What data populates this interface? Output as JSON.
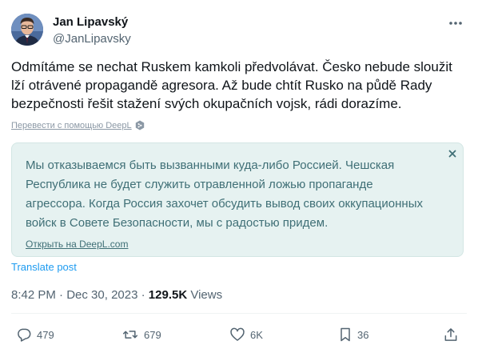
{
  "author": {
    "name": "Jan Lipavský",
    "handle": "@JanLipavsky"
  },
  "tweet": {
    "lines": [
      "Odmítáme se nechat Ruskem kamkoli předvolávat. Česko nebude sloužit",
      "lží otrávené propagandě agresora. Až bude chtít Rusko na půdě Rady",
      "bezpečnosti řešit stažení svých okupačních vojsk, rádi dorazíme."
    ]
  },
  "deepl_credit": "Перевести с помощью DeepL",
  "translation": {
    "lines": [
      "Мы отказываемся быть вызванными куда-либо Россией. Чешская",
      "Республика не будет служить отравленной ложью пропаганде",
      "агрессора. Когда Россия захочет обсудить вывод своих оккупационных",
      "войск в Совете Безопасности, мы с радостью придем."
    ],
    "open_link": "Открыть на DeepL.com"
  },
  "translate_post": "Translate post",
  "meta": {
    "time": "8:42 PM",
    "separator": "·",
    "date": "Dec 30, 2023",
    "views_count": "129.5K",
    "views_label": "Views"
  },
  "actions": {
    "replies": "479",
    "reposts": "679",
    "likes": "6K",
    "bookmarks": "36"
  },
  "icons": {
    "more": "more-horizontal-icon",
    "reply": "reply-icon",
    "repost": "repost-icon",
    "like": "heart-icon",
    "bookmark": "bookmark-icon",
    "share": "share-icon",
    "close": "close-icon",
    "deepl": "deepl-logo-icon"
  },
  "colors": {
    "text": "#0f1419",
    "muted": "#536471",
    "link": "#1d9bf0",
    "translation_bg": "#e6f2f1",
    "translation_text": "#3f6f76"
  }
}
